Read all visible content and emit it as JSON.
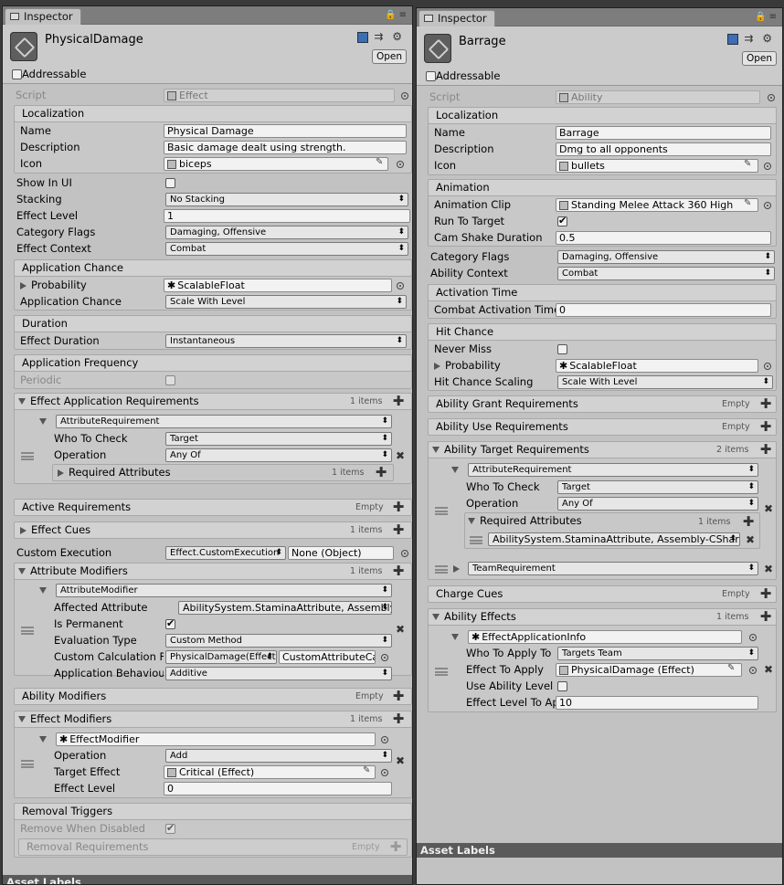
{
  "left": {
    "tab": "Inspector",
    "object_name": "PhysicalDamage",
    "open_label": "Open",
    "addressable": "Addressable",
    "script_label": "Script",
    "script_value": "Effect",
    "localization": {
      "title": "Localization",
      "name_label": "Name",
      "name_value": "Physical Damage",
      "desc_label": "Description",
      "desc_value": "Basic damage dealt using strength.",
      "icon_label": "Icon",
      "icon_value": "biceps"
    },
    "show_in_ui": "Show In UI",
    "stacking_label": "Stacking",
    "stacking_value": "No Stacking",
    "effect_level_label": "Effect Level",
    "effect_level_value": "1",
    "category_flags_label": "Category Flags",
    "category_flags_value": "Damaging,  Offensive",
    "effect_context_label": "Effect Context",
    "effect_context_value": "Combat",
    "app_chance": {
      "title": "Application Chance",
      "probability_label": "Probability",
      "probability_value": "ScalableFloat",
      "chance_label": "Application Chance",
      "chance_value": "Scale With Level"
    },
    "duration": {
      "title": "Duration",
      "label": "Effect Duration",
      "value": "Instantaneous"
    },
    "frequency": {
      "title": "Application Frequency",
      "periodic": "Periodic"
    },
    "app_req": {
      "title": "Effect Application Requirements",
      "count": "1 items",
      "item": "AttributeRequirement",
      "who_label": "Who To Check",
      "who_value": "Target",
      "op_label": "Operation",
      "op_value": "Any Of",
      "req_attr": "Required Attributes",
      "req_count": "1 items"
    },
    "active_req": {
      "title": "Active Requirements",
      "count": "Empty"
    },
    "cues": {
      "title": "Effect Cues",
      "count": "1 items"
    },
    "custom_exec": {
      "label": "Custom Execution",
      "value": "Effect.CustomExecution",
      "obj": "None (Object)"
    },
    "attr_mod": {
      "title": "Attribute Modifiers",
      "count": "1 items",
      "item": "AttributeModifier",
      "affected_label": "Affected Attribute",
      "affected_value": "AbilitySystem.StaminaAttribute, Assembly-CSharp",
      "perm_label": "Is Permanent",
      "eval_label": "Evaluation Type",
      "eval_value": "Custom Method",
      "calc_label": "Custom Calculation Function",
      "calc_value": "PhysicalDamage(Effect)",
      "calc_value2": "CustomAttributeCalc",
      "behav_label": "Application Behaviour",
      "behav_value": "Additive"
    },
    "ability_mod": {
      "title": "Ability Modifiers",
      "count": "Empty"
    },
    "effect_mod": {
      "title": "Effect Modifiers",
      "count": "1 items",
      "item": "EffectModifier",
      "op_label": "Operation",
      "op_value": "Add",
      "target_label": "Target Effect",
      "target_value": "Critical (Effect)",
      "level_label": "Effect Level",
      "level_value": "0"
    },
    "removal": {
      "title": "Removal Triggers",
      "disabled_label": "Remove When Disabled",
      "req_label": "Removal Requirements",
      "req_count": "Empty"
    },
    "footer": "Asset Labels"
  },
  "right": {
    "tab": "Inspector",
    "object_name": "Barrage",
    "open_label": "Open",
    "addressable": "Addressable",
    "script_label": "Script",
    "script_value": "Ability",
    "localization": {
      "title": "Localization",
      "name_label": "Name",
      "name_value": "Barrage",
      "desc_label": "Description",
      "desc_value": "Dmg to all opponents",
      "icon_label": "Icon",
      "icon_value": "bullets"
    },
    "animation": {
      "title": "Animation",
      "clip_label": "Animation Clip",
      "clip_value": "Standing Melee Attack 360 High",
      "run_label": "Run To Target",
      "shake_label": "Cam Shake Duration",
      "shake_value": "0.5"
    },
    "category_flags_label": "Category Flags",
    "category_flags_value": "Damaging,  Offensive",
    "ability_context_label": "Ability Context",
    "ability_context_value": "Combat",
    "activation": {
      "title": "Activation Time",
      "label": "Combat Activation Time",
      "value": "0"
    },
    "hit": {
      "title": "Hit Chance",
      "never_label": "Never Miss",
      "prob_label": "Probability",
      "prob_value": "ScalableFloat",
      "scaling_label": "Hit Chance Scaling",
      "scaling_value": "Scale With Level"
    },
    "grant_req": {
      "title": "Ability Grant Requirements",
      "count": "Empty"
    },
    "use_req": {
      "title": "Ability Use Requirements",
      "count": "Empty"
    },
    "target_req": {
      "title": "Ability Target Requirements",
      "count": "2 items",
      "item": "AttributeRequirement",
      "who_label": "Who To Check",
      "who_value": "Target",
      "op_label": "Operation",
      "op_value": "Any Of",
      "req_attr": "Required Attributes",
      "req_count": "1 items",
      "attr_value": "AbilitySystem.StaminaAttribute, Assembly-CSharp",
      "item2": "TeamRequirement"
    },
    "charge": {
      "title": "Charge Cues",
      "count": "Empty"
    },
    "effects": {
      "title": "Ability Effects",
      "count": "1 items",
      "item": "EffectApplicationInfo",
      "who_label": "Who To Apply To",
      "who_value": "Targets Team",
      "effect_label": "Effect To Apply",
      "effect_value": "PhysicalDamage (Effect)",
      "use_level_label": "Use Ability Level",
      "level_label": "Effect Level To Apply",
      "level_value": "10"
    },
    "footer": "Asset Labels"
  }
}
